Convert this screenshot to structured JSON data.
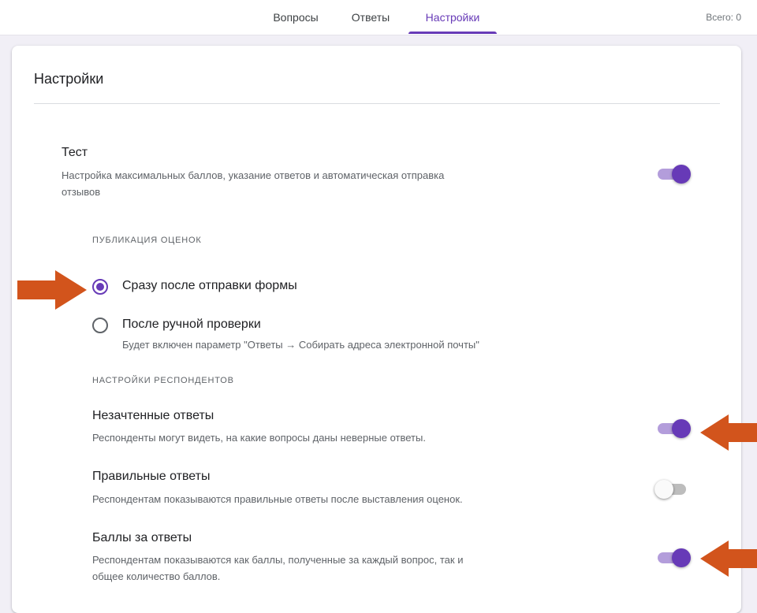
{
  "tabs": [
    {
      "label": "Вопросы",
      "active": false
    },
    {
      "label": "Ответы",
      "active": false
    },
    {
      "label": "Настройки",
      "active": true
    }
  ],
  "total_label": "Всего: 0",
  "card": {
    "title": "Настройки"
  },
  "test": {
    "title": "Тест",
    "description_line1": "Настройка максимальных баллов, указание ответов и автоматическая отправка",
    "description_line2": "отзывов",
    "toggle_on": true
  },
  "grade_publication": {
    "header": "ПУБЛИКАЦИЯ ОЦЕНОК",
    "options": [
      {
        "label": "Сразу после отправки формы",
        "selected": true
      },
      {
        "label": "После ручной проверки",
        "selected": false,
        "hint": "Будет включен параметр \"Ответы → Собирать адреса электронной почты\""
      }
    ]
  },
  "respondent_settings": {
    "header": "НАСТРОЙКИ РЕСПОНДЕНТОВ",
    "items": [
      {
        "title": "Незачтенные ответы",
        "description_line1": "Респонденты могут видеть, на какие вопросы даны неверные ответы.",
        "description_line2": "",
        "toggle_on": true
      },
      {
        "title": "Правильные ответы",
        "description_line1": "Респондентам показываются правильные ответы после выставления оценок.",
        "description_line2": "",
        "toggle_on": false
      },
      {
        "title": "Баллы за ответы",
        "description_line1": "Респондентам показываются как баллы, полученные за каждый вопрос, так и",
        "description_line2": "общее количество баллов.",
        "toggle_on": true
      }
    ]
  },
  "colors": {
    "accent": "#673ab7",
    "accent_light": "#b39ddb",
    "annotation_arrow": "#d2541c"
  }
}
